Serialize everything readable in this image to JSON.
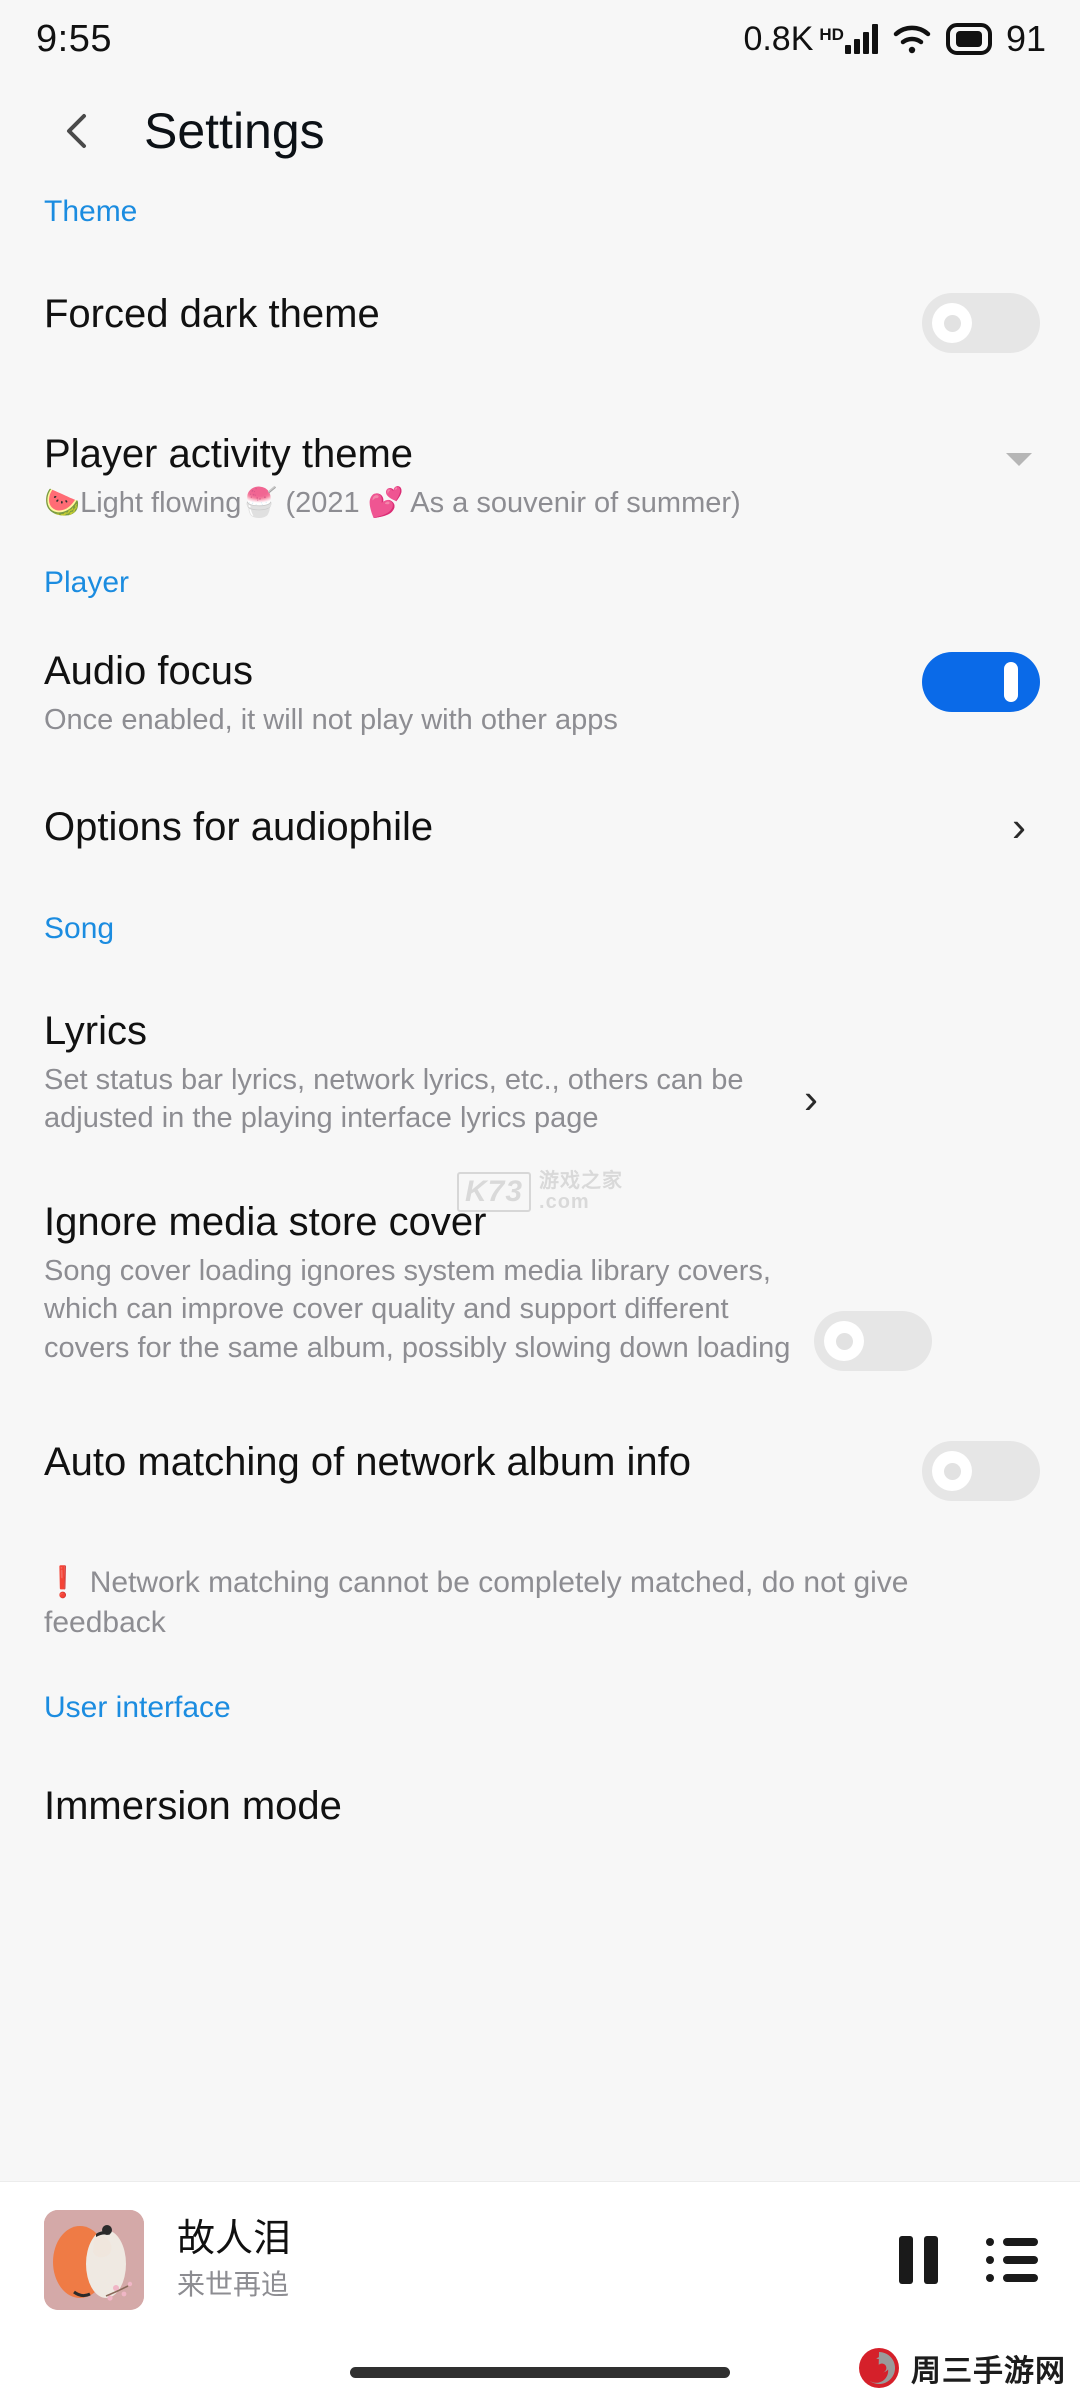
{
  "statusbar": {
    "time": "9:55",
    "network_speed": "0.8K",
    "hd_label": "HD",
    "signal_icon": "signal-bars-icon",
    "wifi_icon": "wifi-icon",
    "battery_icon": "battery-icon",
    "battery_level": "91"
  },
  "appbar": {
    "back_icon": "back-chevron-icon",
    "title": "Settings"
  },
  "sections": [
    {
      "label": "Theme"
    },
    {
      "label": "Player"
    },
    {
      "label": "Song"
    },
    {
      "label": "User interface"
    }
  ],
  "rows": {
    "forced_dark_theme": {
      "title": "Forced dark theme",
      "toggle_state": "off"
    },
    "player_activity_theme": {
      "title": "Player activity theme",
      "subtitle": "🍉Light flowing🍧 (2021 💕 As a souvenir of summer)",
      "trailing_icon": "caret-down-icon"
    },
    "audio_focus": {
      "title": "Audio focus",
      "subtitle": "Once enabled, it will not play with other apps",
      "toggle_state": "on"
    },
    "options_for_audiophile": {
      "title": "Options for audiophile",
      "trailing_icon": "chevron-right-icon",
      "chevron": "›"
    },
    "lyrics": {
      "title": "Lyrics",
      "subtitle": "Set status bar lyrics, network lyrics, etc., others can be adjusted in the playing interface lyrics page",
      "trailing_icon": "chevron-right-icon",
      "chevron": "›"
    },
    "ignore_media_store_cover": {
      "title": "Ignore media store cover",
      "subtitle": "Song cover loading ignores system media library covers, which can improve cover quality and support different covers for the same album, possibly slowing down loading",
      "toggle_state": "off"
    },
    "auto_matching_network_album_info": {
      "title": "Auto matching of network album info",
      "toggle_state": "off"
    },
    "network_warning": {
      "bang": "❗",
      "text": "Network matching cannot be completely matched, do not give feedback"
    },
    "immersion_mode": {
      "title": "Immersion mode"
    }
  },
  "miniplayer": {
    "album_art": "album-art-thumbnail",
    "song_title": "故人泪",
    "artist": "来世再追",
    "pause_icon": "pause-icon",
    "queue_icon": "playlist-queue-icon"
  },
  "watermarks": {
    "center": {
      "logo": "K73",
      "cn_top": "游戏之家",
      "cn_bottom": ".com"
    },
    "bottom_right": {
      "logo_icon": "spiral-logo-icon",
      "text": "周三手游网"
    }
  },
  "colors": {
    "accent_blue": "#1b8ce0",
    "toggle_on": "#0a6ae8",
    "toggle_off": "#e6e6e6",
    "page_bg": "#f7f7f7",
    "primary_text": "#111111",
    "secondary_text": "#8d8d92",
    "warning_red": "#e02020"
  }
}
